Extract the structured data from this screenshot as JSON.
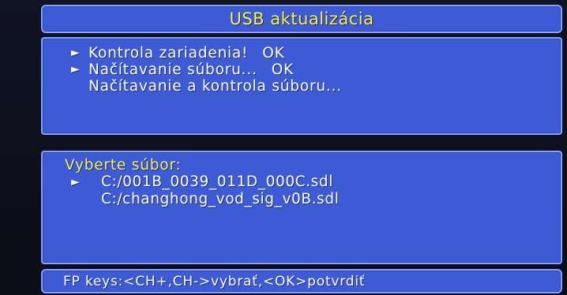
{
  "title": "USB aktualizácia",
  "status": {
    "lines": [
      {
        "marker": "►",
        "text": "Kontrola zariadenia!",
        "result": "OK"
      },
      {
        "marker": "►",
        "text": "Načítavanie súboru...",
        "result": "OK"
      },
      {
        "marker": "",
        "text": "Načítavanie a kontrola súboru...",
        "result": ""
      }
    ]
  },
  "files": {
    "prompt": "Vyberte súbor:",
    "items": [
      {
        "marker": "►",
        "name": "C:/001B_0039_011D_000C.sdl"
      },
      {
        "marker": "",
        "name": "C:/changhong_vod_sig_v0B.sdl"
      }
    ]
  },
  "footer": {
    "hint": "FP keys:<CH+,CH->vybrať,<OK>potvrdiť"
  },
  "colors": {
    "panel": "#3e5bd6",
    "border": "#8aa0ff",
    "highlight_text": "#f7ef5a",
    "text": "#ffffff"
  }
}
